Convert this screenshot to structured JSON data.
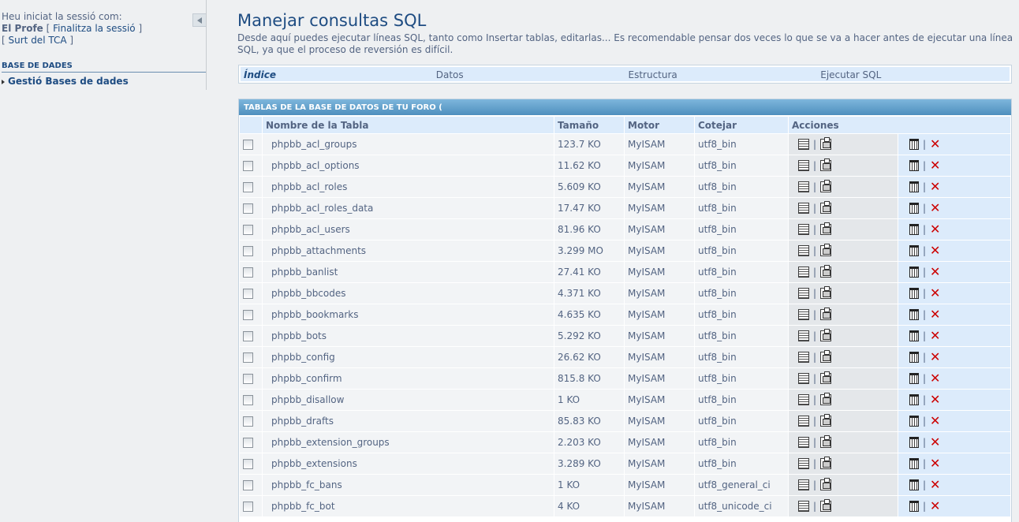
{
  "sidebar": {
    "login_prefix": "Heu iniciat la sessió com:",
    "username": "El Profe",
    "logout_link": "Finalitza la sessió",
    "exit_link": "Surt del TCA",
    "section_title": "BASE DE DADES",
    "nav_item": "Gestió Bases de dades"
  },
  "main": {
    "title": "Manejar consultas SQL",
    "description": "Desde aquí puedes ejecutar líneas SQL, tanto como Insertar tablas, editarlas... Es recomendable pensar dos veces lo que se va a hacer antes de ejecutar una línea SQL, ya que el proceso de reversión es difícil.",
    "tabs": [
      "Índice",
      "Datos",
      "Estructura",
      "Ejecutar SQL"
    ],
    "table_caption": "TABLAS DE LA BASE DE DATOS DE TU FORO (",
    "columns": [
      "Nombre de la Tabla",
      "Tamaño",
      "Motor",
      "Cotejar",
      "Acciones"
    ],
    "rows": [
      {
        "name": "phpbb_acl_groups",
        "size": "123.7 KO",
        "engine": "MyISAM",
        "collation": "utf8_bin"
      },
      {
        "name": "phpbb_acl_options",
        "size": "11.62 KO",
        "engine": "MyISAM",
        "collation": "utf8_bin"
      },
      {
        "name": "phpbb_acl_roles",
        "size": "5.609 KO",
        "engine": "MyISAM",
        "collation": "utf8_bin"
      },
      {
        "name": "phpbb_acl_roles_data",
        "size": "17.47 KO",
        "engine": "MyISAM",
        "collation": "utf8_bin"
      },
      {
        "name": "phpbb_acl_users",
        "size": "81.96 KO",
        "engine": "MyISAM",
        "collation": "utf8_bin"
      },
      {
        "name": "phpbb_attachments",
        "size": "3.299 MO",
        "engine": "MyISAM",
        "collation": "utf8_bin"
      },
      {
        "name": "phpbb_banlist",
        "size": "27.41 KO",
        "engine": "MyISAM",
        "collation": "utf8_bin"
      },
      {
        "name": "phpbb_bbcodes",
        "size": "4.371 KO",
        "engine": "MyISAM",
        "collation": "utf8_bin"
      },
      {
        "name": "phpbb_bookmarks",
        "size": "4.635 KO",
        "engine": "MyISAM",
        "collation": "utf8_bin"
      },
      {
        "name": "phpbb_bots",
        "size": "5.292 KO",
        "engine": "MyISAM",
        "collation": "utf8_bin"
      },
      {
        "name": "phpbb_config",
        "size": "26.62 KO",
        "engine": "MyISAM",
        "collation": "utf8_bin"
      },
      {
        "name": "phpbb_confirm",
        "size": "815.8 KO",
        "engine": "MyISAM",
        "collation": "utf8_bin"
      },
      {
        "name": "phpbb_disallow",
        "size": "1 KO",
        "engine": "MyISAM",
        "collation": "utf8_bin"
      },
      {
        "name": "phpbb_drafts",
        "size": "85.83 KO",
        "engine": "MyISAM",
        "collation": "utf8_bin"
      },
      {
        "name": "phpbb_extension_groups",
        "size": "2.203 KO",
        "engine": "MyISAM",
        "collation": "utf8_bin"
      },
      {
        "name": "phpbb_extensions",
        "size": "3.289 KO",
        "engine": "MyISAM",
        "collation": "utf8_bin"
      },
      {
        "name": "phpbb_fc_bans",
        "size": "1 KO",
        "engine": "MyISAM",
        "collation": "utf8_general_ci"
      },
      {
        "name": "phpbb_fc_bot",
        "size": "4 KO",
        "engine": "MyISAM",
        "collation": "utf8_unicode_ci"
      }
    ],
    "action_separator": "|",
    "icons": {
      "browse": "browse-icon",
      "properties": "properties-icon",
      "empty": "empty-table-icon",
      "drop": "drop-table-icon"
    }
  }
}
